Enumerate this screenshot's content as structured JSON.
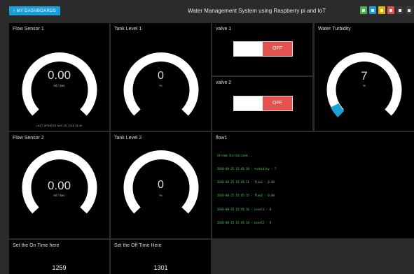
{
  "header": {
    "back_label": "MY DASHBOARDS",
    "title": "Water Management System using Raspberry pi and IoT",
    "tools": [
      {
        "name": "green-tool-icon",
        "color": "#4caf50"
      },
      {
        "name": "blue-tool-icon",
        "color": "#1a9fd9"
      },
      {
        "name": "yellow-tool-icon",
        "color": "#e3b300"
      },
      {
        "name": "red-tool-icon",
        "color": "#e2534f"
      },
      {
        "name": "dark-tool-icon",
        "color": "#3b3b3b"
      },
      {
        "name": "expand-icon",
        "color": "#3b3b3b"
      }
    ]
  },
  "widgets": {
    "flow1": {
      "title": "Flow Sensor 1",
      "value": "0.00",
      "unit": "ml / Sec",
      "updated": "LAST UPDATED AUG 25, 2018 15:45"
    },
    "tank1": {
      "title": "Tank Level 1",
      "value": "0",
      "unit": "%"
    },
    "valve1": {
      "title": "valve 1",
      "state": "OFF"
    },
    "valve2": {
      "title": "valve 2",
      "state": "OFF"
    },
    "turbidity": {
      "title": "Water Turbidity",
      "value": "7",
      "unit": "%",
      "level": 0.07
    },
    "flow2": {
      "title": "Flow Sensor 2",
      "value": "0.00",
      "unit": "ml / Sec"
    },
    "tank2": {
      "title": "Tank Level 2",
      "value": "0",
      "unit": "%"
    },
    "log": {
      "title": "flow1",
      "lines": [
        "Stream Initialized...",
        "2018-08-25 15:45:10 - turbidity - 7",
        "2018-08-25 15:45:11 - flow1 - 0.00",
        "2018-08-25 15:45:15 - flow2 - 0.00",
        "2018-08-25 15:45:16 - Level1 - 0",
        "2018-08-25 15:45:18 - Level2 - 0"
      ]
    },
    "on_time": {
      "title": "Set the On Time here",
      "value": "1259"
    },
    "off_time": {
      "title": "Set the Off Time Here",
      "value": "1301"
    }
  }
}
